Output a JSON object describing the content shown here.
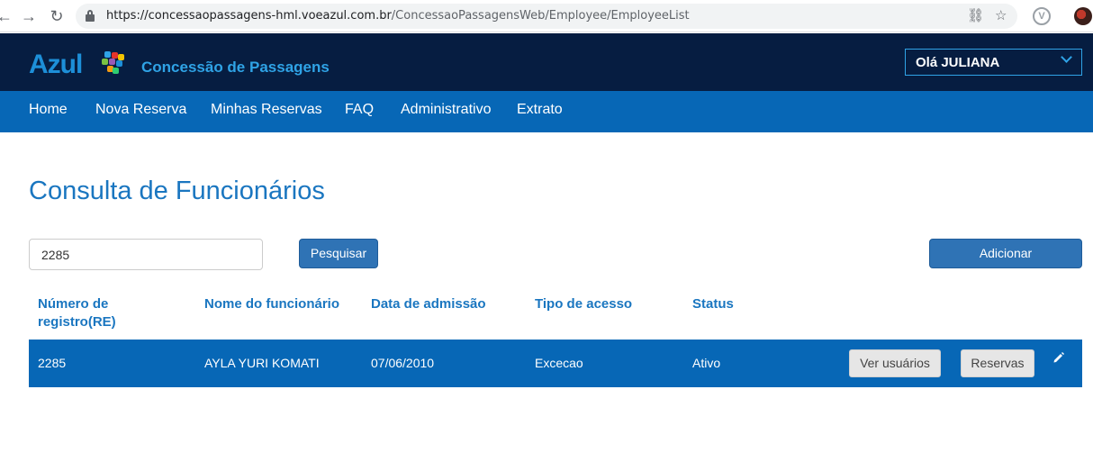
{
  "browser": {
    "url_host": "https://concessaopassagens-hml.voeazul.com.br",
    "url_path": "/ConcessaoPassagensWeb/Employee/EmployeeList"
  },
  "header": {
    "logo_text": "Azul",
    "app_title": "Concessão de Passagens",
    "user_greeting": "Olá JULIANA"
  },
  "nav": {
    "items": [
      "Home",
      "Nova Reserva",
      "Minhas Reservas",
      "FAQ",
      "Administrativo",
      "Extrato"
    ]
  },
  "main": {
    "title": "Consulta de Funcionários",
    "search_value": "2285",
    "search_button": "Pesquisar",
    "add_button": "Adicionar"
  },
  "table": {
    "headers": [
      "Número de registro(RE)",
      "Nome do funcionário",
      "Data de admissão",
      "Tipo de acesso",
      "Status"
    ],
    "rows": [
      {
        "re": "2285",
        "name": "AYLA YURI KOMATI",
        "admission": "07/06/2010",
        "access": "Excecao",
        "status": "Ativo",
        "btn_users": "Ver usuários",
        "btn_bookings": "Reservas"
      }
    ]
  },
  "colors": {
    "header_bg": "#061d41",
    "nav_bg": "#0767b6",
    "accent": "#1a76c0",
    "button": "#2f73b5"
  }
}
